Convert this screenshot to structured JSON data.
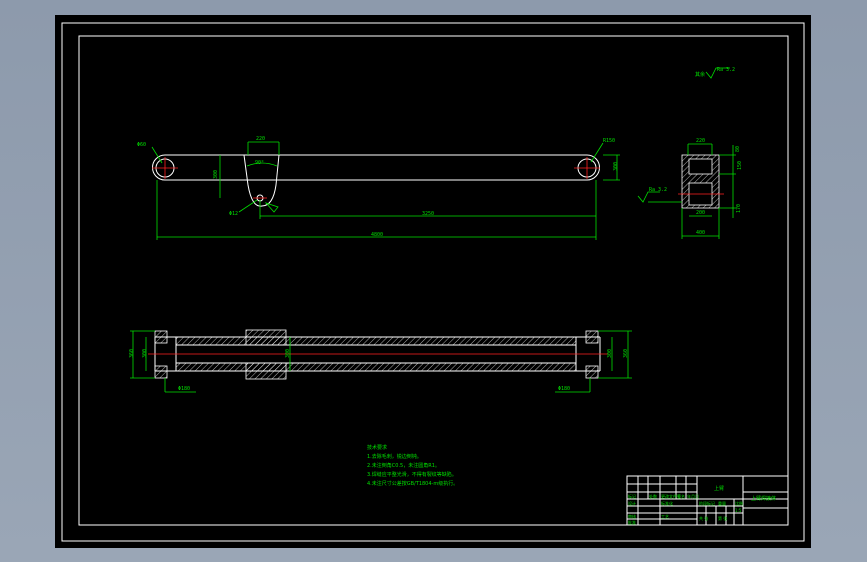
{
  "colors": {
    "background": "#8f9cae",
    "sheet": "#000000",
    "outline": "#ffffff",
    "dimension": "#00e000",
    "centerline": "#ff2020"
  },
  "top_view": {
    "dim_overall": "4800",
    "dim_span": "3250",
    "dim_width": "220",
    "dim_height": "300",
    "dim_angle": "90°",
    "dim_left_hole": "Φ60",
    "dim_right_hole": "R150",
    "dim_small_hole": "Φ12"
  },
  "side_view": {
    "dim_top": "220",
    "dim_bottom": "400",
    "dim_inner": "200",
    "dims_right": [
      "80",
      "150",
      "170"
    ],
    "surface_note": "Ra 3.2"
  },
  "roughness_note": "Ra 3.2",
  "section_view": {
    "dim_left_height": "360",
    "dim_left_inner": "300",
    "dim_right_height": "360",
    "dim_right_inner": "300",
    "dim_mid": "300",
    "dim_left_bottom": "Φ180",
    "dim_right_bottom": "Φ180"
  },
  "notes": {
    "heading": "技术要求",
    "items": [
      "1.去除毛刺，锐边倒钝。",
      "2.未注倒角C0.5，未注圆角R1。",
      "3.焊缝应平整光滑，不得有裂纹等缺陷。",
      "4.未注尺寸公差按GB/T1804-m级执行。"
    ]
  },
  "title_block": {
    "part_name": "上臂",
    "drawing_name": "上臂焊接体",
    "cells": [
      "标记",
      "处数",
      "分区",
      "更改文件号",
      "签名",
      "年月日",
      "设计",
      "标准化",
      "阶段标记",
      "重量",
      "比例",
      "1:5",
      "审核",
      "工艺",
      "批准",
      "共 张",
      "第 张"
    ]
  }
}
